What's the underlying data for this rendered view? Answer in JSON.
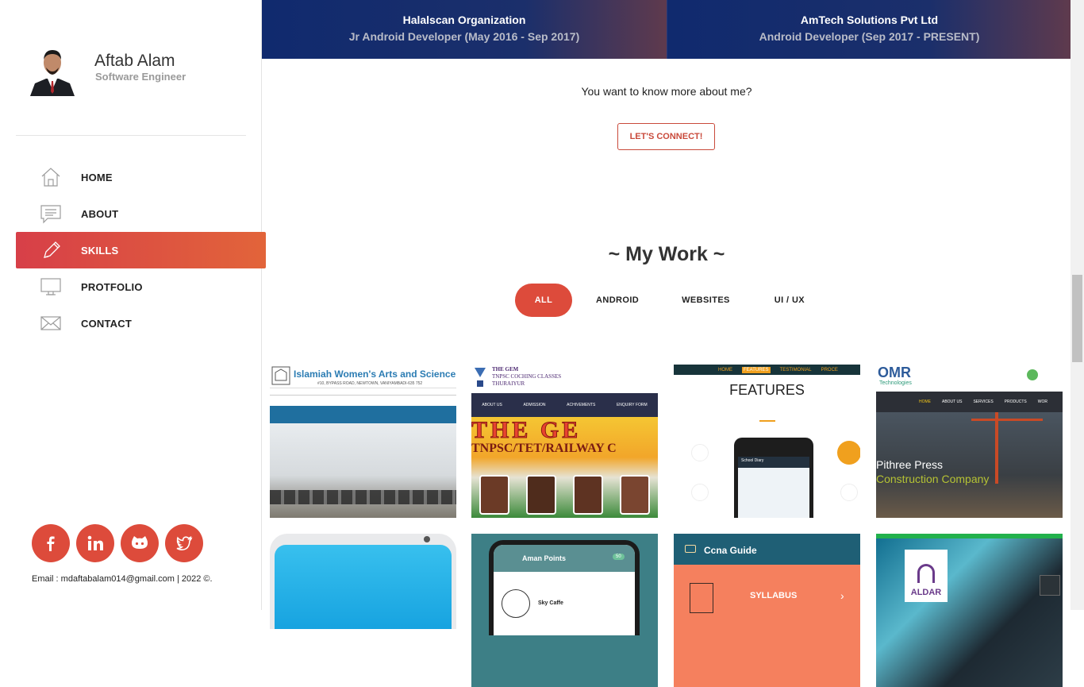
{
  "profile": {
    "name": "Aftab Alam",
    "role": "Software Engineer"
  },
  "nav": [
    {
      "label": "HOME",
      "icon": "home-icon"
    },
    {
      "label": "ABOUT",
      "icon": "chat-icon"
    },
    {
      "label": "SKILLS",
      "icon": "pencil-icon",
      "active": true
    },
    {
      "label": "PROTFOLIO",
      "icon": "monitor-icon"
    },
    {
      "label": "CONTACT",
      "icon": "envelope-icon"
    }
  ],
  "socials": [
    "facebook-icon",
    "linkedin-icon",
    "github-icon",
    "twitter-icon"
  ],
  "footer": "Email : mdaftabalam014@gmail.com | 2022 ©.",
  "experience": [
    {
      "company": "Halalscan Organization",
      "role": "Jr Android Developer (May 2016 - Sep 2017)"
    },
    {
      "company": "AmTech Solutions Pvt Ltd",
      "role": "Android Developer (Sep 2017 - PRESENT)"
    }
  ],
  "know_more": "You want to know more about me?",
  "connect_label": "LET'S CONNECT!",
  "work_title": "~ My Work ~",
  "filters": [
    "ALL",
    "ANDROID",
    "WEBSITES",
    "UI / UX"
  ],
  "works": [
    {
      "t1": "Islamiah Women's Arts and Science College",
      "t2": "#10, BYPASS ROAD, NEWTOWN, VANIYAMBADI-635 752"
    },
    {
      "t1": "THE GEM",
      "t2": "TNPSC COCHING CLASSES",
      "t3": "THURAIYUR",
      "banner": "THE GE",
      "sub": "TNPSC/TET/RAILWAY C",
      "menu": [
        "ABOUT US",
        "ADMISSION",
        "ACHIVEMENTS",
        "ENQUIRY FORM"
      ]
    },
    {
      "t1": "FEATURES",
      "menu": [
        "HOME",
        "FEATURES",
        "TESTIMONIAL",
        "PROCE"
      ],
      "app": "School Diary"
    },
    {
      "t1": "OMR",
      "t2": "Technologies",
      "t3": "Pithree Press",
      "t4": "Construction Company",
      "menu": [
        "HOME",
        "ABOUT US",
        "SERVICES",
        "PRODUCTS",
        "WOR"
      ]
    },
    {
      "t1": ""
    },
    {
      "t1": "Aman Points",
      "t2": "Sky Caffe",
      "badge": "50"
    },
    {
      "t1": "Ccna Guide",
      "t2": "SYLLABUS"
    },
    {
      "t1": "ALDAR"
    }
  ]
}
